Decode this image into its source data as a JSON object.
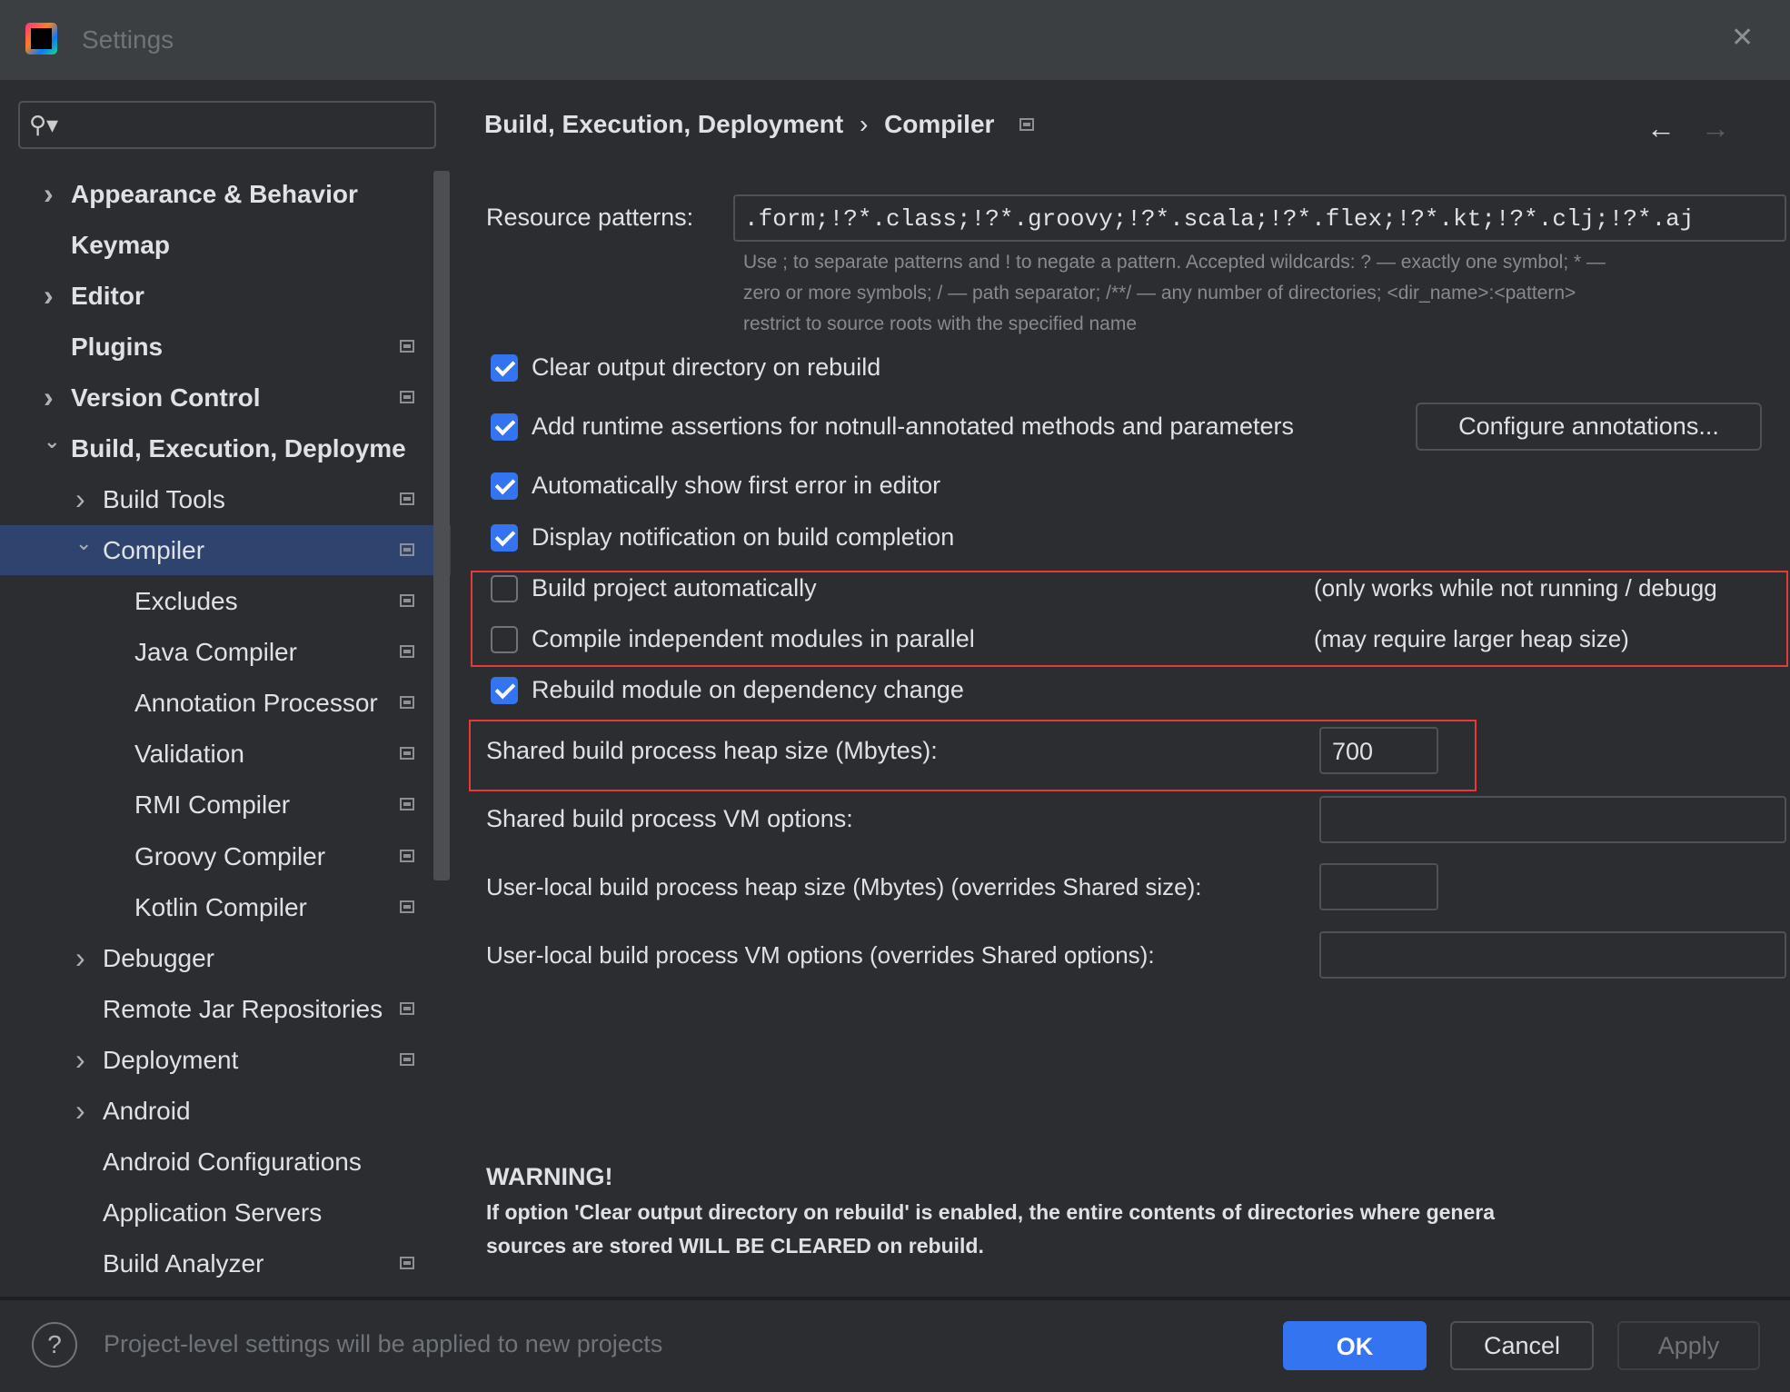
{
  "window": {
    "title": "Settings",
    "close_icon": "close-icon",
    "logo": "IJ"
  },
  "search": {
    "placeholder": "",
    "icon": "search-icon"
  },
  "sidebar": {
    "items": [
      {
        "label": "Appearance & Behavior",
        "level": 0,
        "bold": true,
        "chevron": "right",
        "gear": false
      },
      {
        "label": "Keymap",
        "level": 0,
        "bold": true,
        "chevron": "",
        "gear": false
      },
      {
        "label": "Editor",
        "level": 0,
        "bold": true,
        "chevron": "right",
        "gear": false
      },
      {
        "label": "Plugins",
        "level": 0,
        "bold": true,
        "chevron": "",
        "gear": true
      },
      {
        "label": "Version Control",
        "level": 0,
        "bold": true,
        "chevron": "right",
        "gear": true
      },
      {
        "label": "Build, Execution, Deployme",
        "level": 0,
        "bold": true,
        "chevron": "down",
        "gear": false
      },
      {
        "label": "Build Tools",
        "level": 1,
        "chevron": "right",
        "gear": true
      },
      {
        "label": "Compiler",
        "level": 1,
        "chevron": "down",
        "gear": true,
        "selected": true
      },
      {
        "label": "Excludes",
        "level": 2,
        "chevron": "",
        "gear": true
      },
      {
        "label": "Java Compiler",
        "level": 2,
        "chevron": "",
        "gear": true
      },
      {
        "label": "Annotation Processor",
        "level": 2,
        "chevron": "",
        "gear": true
      },
      {
        "label": "Validation",
        "level": 2,
        "chevron": "",
        "gear": true
      },
      {
        "label": "RMI Compiler",
        "level": 2,
        "chevron": "",
        "gear": true
      },
      {
        "label": "Groovy Compiler",
        "level": 2,
        "chevron": "",
        "gear": true
      },
      {
        "label": "Kotlin Compiler",
        "level": 2,
        "chevron": "",
        "gear": true
      },
      {
        "label": "Debugger",
        "level": 1,
        "chevron": "right",
        "gear": false
      },
      {
        "label": "Remote Jar Repositories",
        "level": 1,
        "chevron": "",
        "gear": true
      },
      {
        "label": "Deployment",
        "level": 1,
        "chevron": "right",
        "gear": true
      },
      {
        "label": "Android",
        "level": 1,
        "chevron": "right",
        "gear": false
      },
      {
        "label": "Android Configurations",
        "level": 1,
        "chevron": "",
        "gear": false
      },
      {
        "label": "Application Servers",
        "level": 1,
        "chevron": "",
        "gear": false
      },
      {
        "label": "Build Analyzer",
        "level": 1,
        "chevron": "",
        "gear": true
      }
    ]
  },
  "breadcrumb": {
    "parent": "Build, Execution, Deployment",
    "separator": "›",
    "current": "Compiler"
  },
  "main": {
    "resource_label": "Resource patterns:",
    "resource_value": ".form;!?*.class;!?*.groovy;!?*.scala;!?*.flex;!?*.kt;!?*.clj;!?*.aj",
    "hint": [
      "Use ; to separate patterns and ! to negate a pattern. Accepted wildcards: ? — exactly one symbol; * —",
      "zero or more symbols; / — path separator; /**/ — any number of directories; <dir_name>:<pattern>",
      "restrict to source roots with the specified name"
    ],
    "checkboxes": [
      {
        "label": "Clear output directory on rebuild",
        "checked": true,
        "note": ""
      },
      {
        "label": "Add runtime assertions for notnull-annotated methods and parameters",
        "checked": true,
        "note": ""
      },
      {
        "label": "Automatically show first error in editor",
        "checked": true,
        "note": ""
      },
      {
        "label": "Display notification on build completion",
        "checked": true,
        "note": ""
      },
      {
        "label": "Build project automatically",
        "checked": false,
        "note": "(only works while not running / debugg"
      },
      {
        "label": "Compile independent modules in parallel",
        "checked": false,
        "note": "(may require larger heap size)"
      },
      {
        "label": "Rebuild module on dependency change",
        "checked": true,
        "note": ""
      }
    ],
    "configure_button": "Configure annotations...",
    "heap_label": "Shared build process heap size (Mbytes):",
    "heap_value": "700",
    "vm_label": "Shared build process VM options:",
    "vm_value": "",
    "user_heap_label": "User-local build process heap size (Mbytes) (overrides Shared size):",
    "user_heap_value": "",
    "user_vm_label": "User-local build process VM options (overrides Shared options):",
    "user_vm_value": "",
    "warning_title": "WARNING!",
    "warning_lines": [
      "If option 'Clear output directory on rebuild' is enabled, the entire contents of directories where genera",
      "sources are stored WILL BE CLEARED on rebuild."
    ]
  },
  "footer": {
    "help": "?",
    "note": "Project-level settings will be applied to new projects",
    "ok": "OK",
    "cancel": "Cancel",
    "apply": "Apply"
  },
  "colors": {
    "accent": "#3574f0",
    "highlight": "#e5393b",
    "selection": "#2e436e",
    "background": "#2b2d30"
  }
}
